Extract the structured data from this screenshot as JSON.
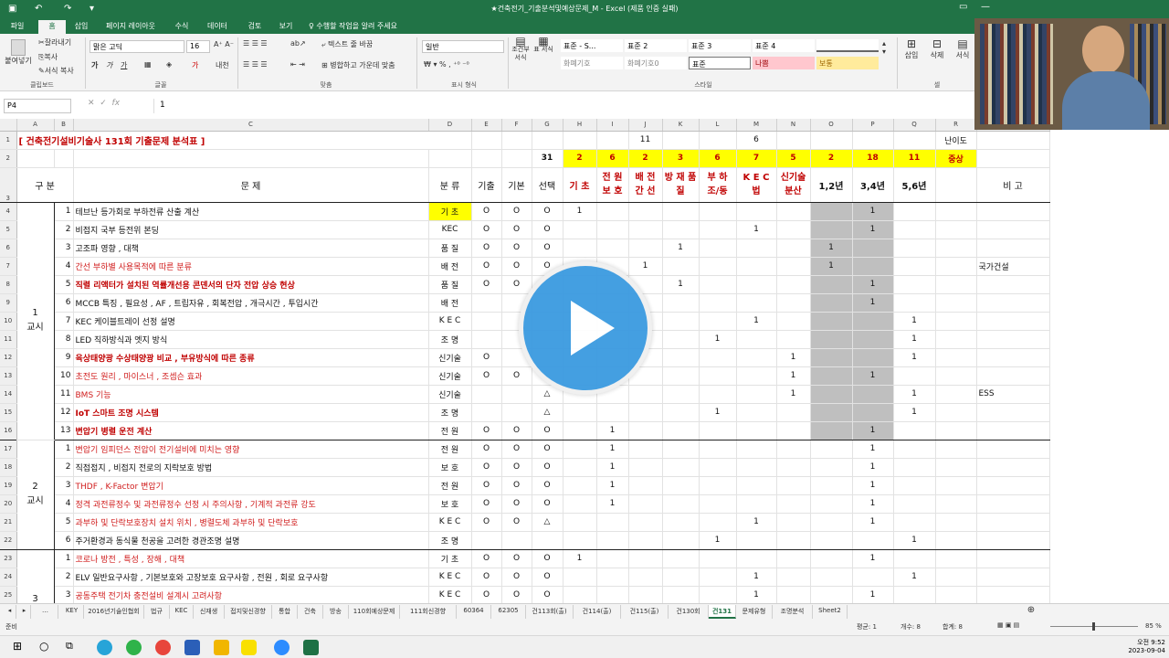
{
  "window": {
    "title": "★건축전기_기출분석및예상문제_M - Excel (제품 인증 실패)",
    "save_icon": "save-icon",
    "undo_icon": "undo-icon",
    "redo_icon": "redo-icon"
  },
  "ribbon_tabs": [
    "파일",
    "홈",
    "삽입",
    "페이지 레이아웃",
    "수식",
    "데이터",
    "검토",
    "보기"
  ],
  "tell_me": "수행할 작업을 알려 주세요",
  "ribbon": {
    "paste": "붙여넣기",
    "cut": "잘라내기",
    "copy": "복사",
    "format_painter": "서식 복사",
    "clipboard": "클립보드",
    "font_name": "맑은 고딕",
    "font_size": "16",
    "font_group": "글꼴",
    "wrap_text": "텍스트 줄 바꿈",
    "merge_center": "병합하고 가운데 맞춤",
    "align_group": "맞춤",
    "number_format": "일반",
    "number_group": "표시 형식",
    "cond_format": "조건부 서식",
    "format_table": "표 서식",
    "styles_group": "스타일",
    "style_cells": [
      {
        "label": "표준 - S...",
        "bg": "#ffffff",
        "fg": "#000000"
      },
      {
        "label": "표준 2",
        "bg": "#ffffff",
        "fg": "#000000"
      },
      {
        "label": "표준 3",
        "bg": "#ffffff",
        "fg": "#000000"
      },
      {
        "label": "표준 4",
        "bg": "#ffffff",
        "fg": "#000000"
      },
      {
        "label": "",
        "bg": "#ffffff",
        "fg": "#000000"
      },
      {
        "label": "화폐기호",
        "bg": "#ffffff",
        "fg": "#888888"
      },
      {
        "label": "화폐기호0",
        "bg": "#ffffff",
        "fg": "#888888"
      },
      {
        "label": "표준",
        "bg": "#ffffff",
        "fg": "#000000"
      },
      {
        "label": "나쁨",
        "bg": "#ffc7ce",
        "fg": "#9c0006"
      },
      {
        "label": "보통",
        "bg": "#ffeb9c",
        "fg": "#9c6500"
      }
    ],
    "insert": "삽입",
    "delete": "삭제",
    "format": "서식",
    "cells_group": "셀"
  },
  "formula_bar": {
    "name_box": "P4",
    "value": "1"
  },
  "columns": [
    "A",
    "B",
    "C",
    "D",
    "E",
    "F",
    "G",
    "H",
    "I",
    "J",
    "K",
    "L",
    "M",
    "N",
    "O",
    "P",
    "Q",
    "R"
  ],
  "sheet": {
    "r1": {
      "row": "1",
      "title": "[ 건축전기설비기술사  131회 기출문제 분석표 ]",
      "i": "11",
      "l": "6",
      "r": "난이도"
    },
    "r2": {
      "row": "2",
      "g": "31",
      "h": "2",
      "i": "6",
      "j": "2",
      "k": "3",
      "l": "6",
      "m": "7",
      "n": "5",
      "o": "2",
      "p": "18",
      "q": "11",
      "r": "중상"
    },
    "r3": {
      "row": "3",
      "a": "구 분",
      "c": "문 제",
      "d": "분 류",
      "e": "기출",
      "f": "기본",
      "g": "선택",
      "h": "기 초",
      "i": "전 원 보 호",
      "j": "배 전 간 선",
      "k": "방 재 품 질",
      "l": "부 하 조/동",
      "m": "K E C 법",
      "n": "신기술 분산",
      "o": "1,2년",
      "p": "3,4년",
      "q": "5,6년",
      "r": "비 고"
    },
    "period1": {
      "label": "1",
      "label2": "교시"
    },
    "period2": {
      "label": "2",
      "label2": "교시"
    },
    "period3": {
      "label": "3"
    },
    "rows": [
      {
        "row": "4",
        "b": "1",
        "c": "테브난 등가회로 부하전류 산출 계산",
        "d": "기 초",
        "e": "O",
        "f": "O",
        "g": "O",
        "h": "1",
        "i": "",
        "j": "",
        "k": "",
        "l": "",
        "m": "",
        "n": "",
        "o": "",
        "p": "1",
        "q": "",
        "r": "",
        "style": "",
        "dy": true
      },
      {
        "row": "5",
        "b": "2",
        "c": "비접지 국부 등전위 본딩",
        "d": "KEC",
        "e": "O",
        "f": "O",
        "g": "O",
        "h": "",
        "i": "",
        "j": "",
        "k": "",
        "l": "",
        "m": "1",
        "n": "",
        "o": "",
        "p": "1",
        "q": "",
        "r": "",
        "style": ""
      },
      {
        "row": "6",
        "b": "3",
        "c": "고조파 영향 , 대책",
        "d": "품 질",
        "e": "O",
        "f": "O",
        "g": "O",
        "h": "",
        "i": "",
        "j": "",
        "k": "1",
        "l": "",
        "m": "",
        "n": "",
        "o": "1",
        "p": "",
        "q": "",
        "r": "",
        "style": ""
      },
      {
        "row": "7",
        "b": "4",
        "c": "간선 부하별 사용목적에 따른 분류",
        "d": "배 전",
        "e": "O",
        "f": "O",
        "g": "O",
        "h": "",
        "i": "",
        "j": "1",
        "k": "",
        "l": "",
        "m": "",
        "n": "",
        "o": "1",
        "p": "",
        "q": "",
        "r": "국가건설",
        "style": "red"
      },
      {
        "row": "8",
        "b": "5",
        "c": "직렬 리액터가 설치된 역률개선용 콘덴서의 단자 전압 상승 현상",
        "d": "품 질",
        "e": "O",
        "f": "O",
        "g": "",
        "h": "",
        "i": "",
        "j": "",
        "k": "1",
        "l": "",
        "m": "",
        "n": "",
        "o": "",
        "p": "1",
        "q": "",
        "r": "",
        "style": "rb"
      },
      {
        "row": "9",
        "b": "6",
        "c": "MCCB  특징 , 필요성 , AF , 트립자유 , 회복전압 , 개극시간 , 투입시간",
        "d": "배 전",
        "e": "",
        "f": "",
        "g": "",
        "h": "",
        "i": "",
        "j": "",
        "k": "",
        "l": "",
        "m": "",
        "n": "",
        "o": "",
        "p": "1",
        "q": "",
        "r": "",
        "style": ""
      },
      {
        "row": "10",
        "b": "7",
        "c": "KEC 케이블트레이 선정 설명",
        "d": "K E C",
        "e": "",
        "f": "",
        "g": "",
        "h": "",
        "i": "",
        "j": "",
        "k": "",
        "l": "",
        "m": "1",
        "n": "",
        "o": "",
        "p": "",
        "q": "1",
        "r": "",
        "style": ""
      },
      {
        "row": "11",
        "b": "8",
        "c": "LED  직하방식과 엣지 방식",
        "d": "조 명",
        "e": "",
        "f": "",
        "g": "",
        "h": "",
        "i": "",
        "j": "",
        "k": "",
        "l": "1",
        "m": "",
        "n": "",
        "o": "",
        "p": "",
        "q": "1",
        "r": "",
        "style": ""
      },
      {
        "row": "12",
        "b": "9",
        "c": "육상태양광 수상태양광 비교 , 부유방식에 따른 종류",
        "d": "신기술",
        "e": "O",
        "f": "",
        "g": "",
        "h": "",
        "i": "",
        "j": "",
        "k": "",
        "l": "",
        "m": "",
        "n": "1",
        "o": "",
        "p": "",
        "q": "1",
        "r": "",
        "style": "rb"
      },
      {
        "row": "13",
        "b": "10",
        "c": "초전도 원리 , 마이스너 , 조셉슨 효과",
        "d": "신기술",
        "e": "O",
        "f": "O",
        "g": "",
        "h": "",
        "i": "",
        "j": "",
        "k": "",
        "l": "",
        "m": "",
        "n": "1",
        "o": "",
        "p": "1",
        "q": "",
        "r": "",
        "style": "red"
      },
      {
        "row": "14",
        "b": "11",
        "c": "BMS 기능",
        "d": "신기술",
        "e": "",
        "f": "",
        "g": "△",
        "h": "",
        "i": "",
        "j": "",
        "k": "",
        "l": "",
        "m": "",
        "n": "1",
        "o": "",
        "p": "",
        "q": "1",
        "r": "ESS",
        "style": "red"
      },
      {
        "row": "15",
        "b": "12",
        "c": "IoT 스마트 조명 시스템",
        "d": "조 명",
        "e": "",
        "f": "",
        "g": "△",
        "h": "",
        "i": "",
        "j": "",
        "k": "",
        "l": "1",
        "m": "",
        "n": "",
        "o": "",
        "p": "",
        "q": "1",
        "r": "",
        "style": "rb"
      },
      {
        "row": "16",
        "b": "13",
        "c": "변압기 병렬 운전 계산",
        "d": "전 원",
        "e": "O",
        "f": "O",
        "g": "O",
        "h": "",
        "i": "1",
        "j": "",
        "k": "",
        "l": "",
        "m": "",
        "n": "",
        "o": "",
        "p": "1",
        "q": "",
        "r": "",
        "style": "rb",
        "bb": true
      },
      {
        "row": "17",
        "b": "1",
        "c": "변압기 임피던스 전압이 전기설비에 미치는 영향",
        "d": "전 원",
        "e": "O",
        "f": "O",
        "g": "O",
        "h": "",
        "i": "1",
        "j": "",
        "k": "",
        "l": "",
        "m": "",
        "n": "",
        "o": "",
        "p": "1",
        "q": "",
        "r": "",
        "style": "red"
      },
      {
        "row": "18",
        "b": "2",
        "c": "직접접지 , 비접지 전로의 지락보호 방법",
        "d": "보 호",
        "e": "O",
        "f": "O",
        "g": "O",
        "h": "",
        "i": "1",
        "j": "",
        "k": "",
        "l": "",
        "m": "",
        "n": "",
        "o": "",
        "p": "1",
        "q": "",
        "r": "",
        "style": ""
      },
      {
        "row": "19",
        "b": "3",
        "c": "THDF ,  K-Factor 변압기",
        "d": "전 원",
        "e": "O",
        "f": "O",
        "g": "O",
        "h": "",
        "i": "1",
        "j": "",
        "k": "",
        "l": "",
        "m": "",
        "n": "",
        "o": "",
        "p": "1",
        "q": "",
        "r": "",
        "style": "red"
      },
      {
        "row": "20",
        "b": "4",
        "c": "정격 과전류정수 및 과전류정수 선정 시 주의사항 , 기계적 과전류 강도",
        "d": "보 호",
        "e": "O",
        "f": "O",
        "g": "O",
        "h": "",
        "i": "1",
        "j": "",
        "k": "",
        "l": "",
        "m": "",
        "n": "",
        "o": "",
        "p": "1",
        "q": "",
        "r": "",
        "style": "red"
      },
      {
        "row": "21",
        "b": "5",
        "c": "과부하 및 단락보호장치 설치 위치 , 병렬도체 과부하 및 단락보호",
        "d": "K E C",
        "e": "O",
        "f": "O",
        "g": "△",
        "h": "",
        "i": "",
        "j": "",
        "k": "",
        "l": "",
        "m": "1",
        "n": "",
        "o": "",
        "p": "1",
        "q": "",
        "r": "",
        "style": "red"
      },
      {
        "row": "22",
        "b": "6",
        "c": "주거환경과 동식물 천공을 고려한 경관조명 설명",
        "d": "조 명",
        "e": "",
        "f": "",
        "g": "",
        "h": "",
        "i": "",
        "j": "",
        "k": "",
        "l": "1",
        "m": "",
        "n": "",
        "o": "",
        "p": "",
        "q": "1",
        "r": "",
        "style": "",
        "bb": true
      },
      {
        "row": "23",
        "b": "1",
        "c": "코로나 방전  , 특성  , 장해  , 대책",
        "d": "기 초",
        "e": "O",
        "f": "O",
        "g": "O",
        "h": "1",
        "i": "",
        "j": "",
        "k": "",
        "l": "",
        "m": "",
        "n": "",
        "o": "",
        "p": "1",
        "q": "",
        "r": "",
        "style": "red"
      },
      {
        "row": "24",
        "b": "2",
        "c": "ELV  일반요구사항 , 기본보호와 고장보호 요구사항 , 전원 , 회로 요구사항",
        "d": "K E C",
        "e": "O",
        "f": "O",
        "g": "O",
        "h": "",
        "i": "",
        "j": "",
        "k": "",
        "l": "",
        "m": "1",
        "n": "",
        "o": "",
        "p": "",
        "q": "1",
        "r": "",
        "style": ""
      },
      {
        "row": "25",
        "b": "3",
        "c": "공동주택 전기차 충전설비 설계시 고려사항",
        "d": "K E C",
        "e": "O",
        "f": "O",
        "g": "O",
        "h": "",
        "i": "",
        "j": "",
        "k": "",
        "l": "",
        "m": "1",
        "n": "",
        "o": "",
        "p": "1",
        "q": "",
        "r": "",
        "style": "red"
      }
    ]
  },
  "sheet_tabs": [
    "KEY",
    "2016년기술인협회",
    "법규",
    "KEC",
    "신재생",
    "접지및신경향",
    "통합",
    "건축",
    "방송",
    "110회예상문제",
    "111회신경향",
    "60364",
    "62305",
    "건113회(출)",
    "건114(출)",
    "건115(출)",
    "건130회",
    "건131",
    "문제유형",
    "조명분석",
    "Sheet2"
  ],
  "active_sheet": "건131",
  "status": {
    "ready": "준비",
    "average": "평균: 1",
    "count": "개수: 8",
    "sum": "합계: 8",
    "zoom": "85 %"
  },
  "taskbar": {
    "time": "오전 9:52",
    "date": "2023-09-04"
  },
  "colors": {
    "excel_green": "#217346",
    "highlight_yellow": "#ffff00",
    "header_red": "#c00000",
    "grey_fill": "#bfbfbf",
    "play_blue": "#3b9ae0"
  }
}
